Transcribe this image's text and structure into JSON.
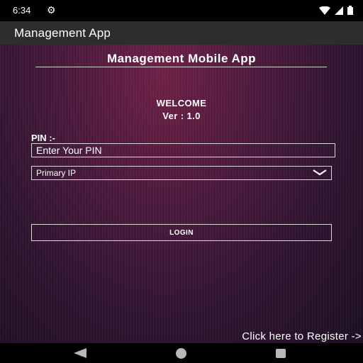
{
  "status_bar": {
    "time": "6:34",
    "icons": [
      "gear-icon",
      "wifi-icon",
      "signal-icon",
      "battery-icon"
    ]
  },
  "app_bar": {
    "title": "Management App"
  },
  "main": {
    "heading": "Management Mobile App",
    "welcome": "WELCOME",
    "version": "Ver : 1.0",
    "pin_label": "PIN :-",
    "pin_input": {
      "value": "",
      "placeholder": "Enter Your PIN"
    },
    "ip_select": {
      "selected": "Primary IP"
    },
    "login_label": "LOGIN",
    "register_link": "Click here to Register ->"
  },
  "nav_bar": {
    "icons": [
      "back-icon",
      "home-icon",
      "recents-icon"
    ]
  },
  "colors": {
    "background_top": "#6e2046",
    "background_bottom": "#1c0f22",
    "app_bar": "#2d2d2d",
    "status_bar": "#000000",
    "text": "#ffffff",
    "border": "#d8d8d8"
  }
}
